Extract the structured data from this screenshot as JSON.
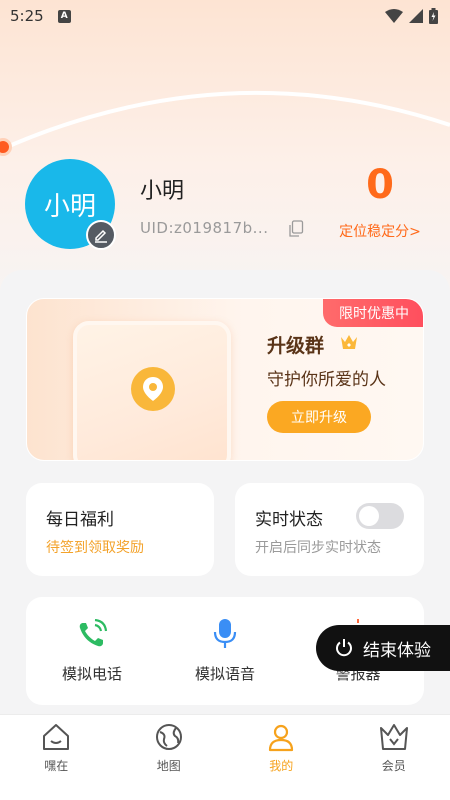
{
  "status_bar": {
    "time": "5:25",
    "notification": "A"
  },
  "profile": {
    "avatar_text": "小明",
    "name": "小明",
    "uid": "UID:z019817b...",
    "score_value": "0",
    "score_label": "定位稳定分>"
  },
  "promo": {
    "badge": "限时优惠中",
    "title": "升级群",
    "subtitle": "守护你所爱的人",
    "button": "立即升级"
  },
  "daily": {
    "title": "每日福利",
    "subtitle": "待签到领取奖励"
  },
  "realtime": {
    "title": "实时状态",
    "subtitle": "开启后同步实时状态",
    "toggle_on": false
  },
  "tools": [
    {
      "label": "模拟电话",
      "icon": "phone-icon"
    },
    {
      "label": "模拟语音",
      "icon": "microphone-icon"
    },
    {
      "label": "警报器",
      "icon": "siren-icon"
    }
  ],
  "end_trial": {
    "label": "结束体验",
    "icon": "power-icon"
  },
  "tabs": [
    {
      "label": "嘿在",
      "icon": "house-icon"
    },
    {
      "label": "地图",
      "icon": "globe-icon"
    },
    {
      "label": "我的",
      "icon": "person-icon",
      "active": true
    },
    {
      "label": "会员",
      "icon": "crown-icon"
    }
  ],
  "colors": {
    "accent": "#f6a21c",
    "score": "#ff6a1a",
    "avatar": "#19b8ea",
    "daily_subtitle": "#f3a22a"
  }
}
